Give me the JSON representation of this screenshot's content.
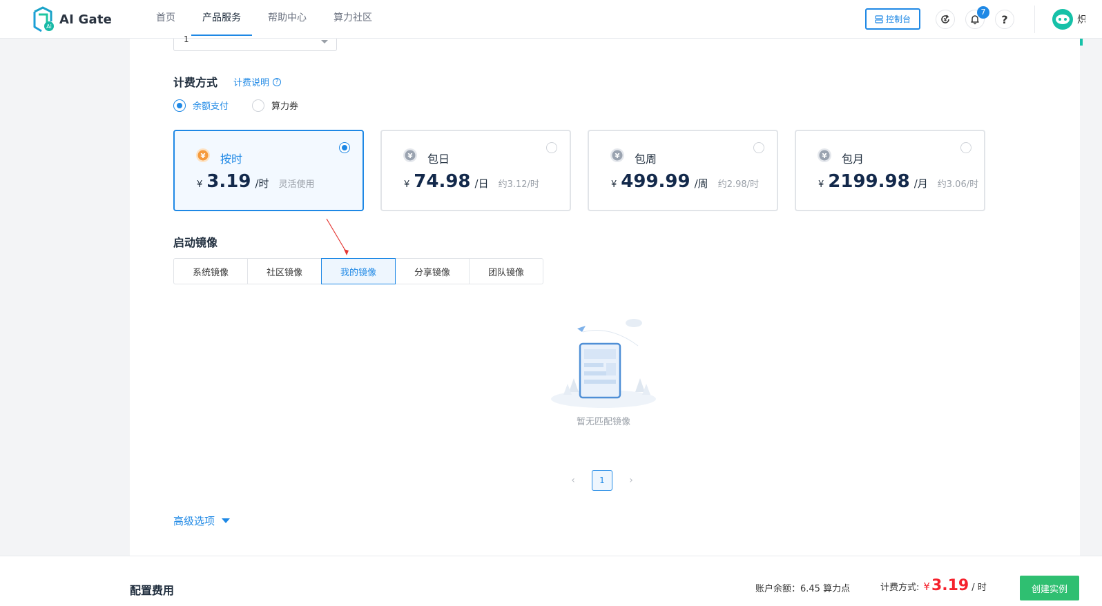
{
  "brand": {
    "name": "AI Gate"
  },
  "nav": {
    "items": [
      {
        "label": "首页"
      },
      {
        "label": "产品服务"
      },
      {
        "label": "帮助中心"
      },
      {
        "label": "算力社区"
      }
    ],
    "active_index": 1
  },
  "header": {
    "console_label": "控制台",
    "notification_count": "7",
    "help_label": "?",
    "username_peek": "炽"
  },
  "form": {
    "select_value": "1",
    "billing": {
      "title": "计费方式",
      "help_label": "计费说明",
      "methods": [
        {
          "label": "余额支付",
          "selected": true
        },
        {
          "label": "算力券",
          "selected": false
        }
      ]
    },
    "plans": [
      {
        "name": "按时",
        "currency": "¥",
        "price": "3.19",
        "unit": "/时",
        "note": "灵活使用",
        "selected": true,
        "icon": "coin-orange-icon"
      },
      {
        "name": "包日",
        "currency": "¥",
        "price": "74.98",
        "unit": "/日",
        "note": "约3.12/时",
        "selected": false,
        "icon": "coin-gray-icon"
      },
      {
        "name": "包周",
        "currency": "¥",
        "price": "499.99",
        "unit": "/周",
        "note": "约2.98/时",
        "selected": false,
        "icon": "coin-gray-icon"
      },
      {
        "name": "包月",
        "currency": "¥",
        "price": "2199.98",
        "unit": "/月",
        "note": "约3.06/时",
        "selected": false,
        "icon": "coin-gray-icon"
      }
    ],
    "image": {
      "title": "启动镜像",
      "tabs": [
        {
          "label": "系统镜像"
        },
        {
          "label": "社区镜像"
        },
        {
          "label": "我的镜像"
        },
        {
          "label": "分享镜像"
        },
        {
          "label": "团队镜像"
        }
      ],
      "active_tab": 2,
      "empty_text": "暂无匹配镜像"
    },
    "pagination": {
      "current": "1"
    },
    "advanced_label": "高级选项"
  },
  "footer": {
    "title": "配置费用",
    "balance_text": "账户余额：6.45 算力点",
    "billing_label": "计费方式:",
    "currency": "¥",
    "price": "3.19",
    "unit": "/ 时",
    "create_label": "创建实例"
  },
  "colors": {
    "accent": "#1e88e5",
    "price_red": "#f5222d",
    "create_green": "#2fbf71",
    "brand_teal": "#16c1a8"
  }
}
